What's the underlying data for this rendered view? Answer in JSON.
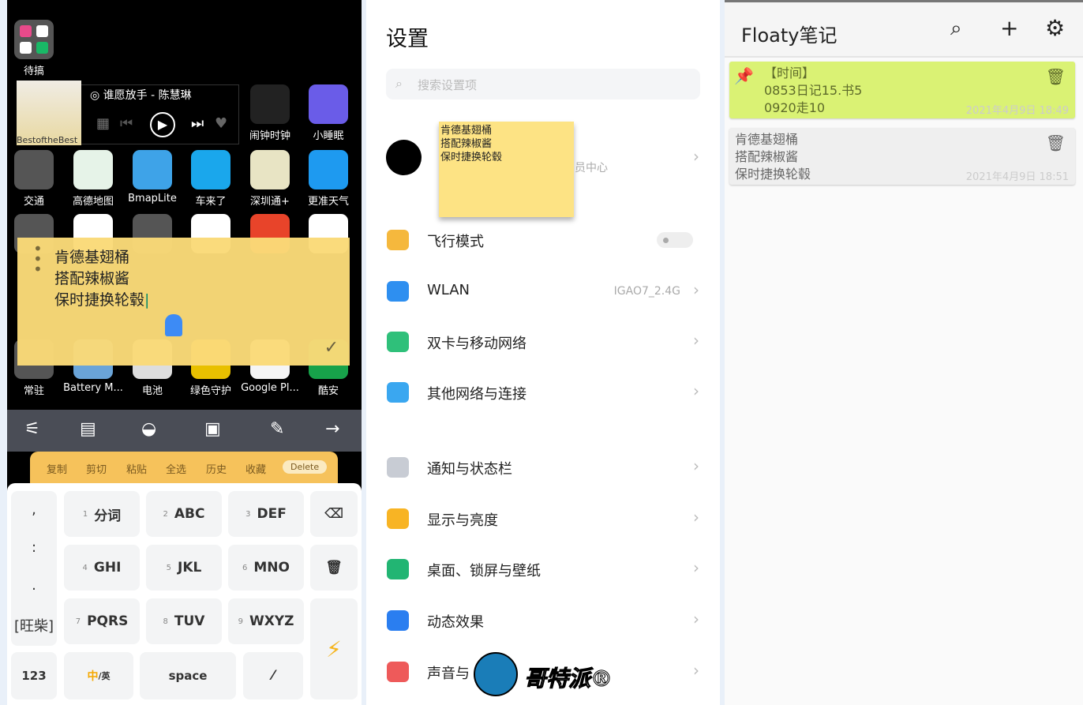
{
  "home": {
    "folder1_label": "待搞",
    "music": {
      "title": "谁愿放手 - 陈慧琳",
      "album_text": "BestoftheBest"
    },
    "apps": [
      {
        "label": "闹钟时钟",
        "color": "#222222"
      },
      {
        "label": "小睡眠",
        "color": "#6a5ce8"
      },
      {
        "label": "交通",
        "color": "#555555"
      },
      {
        "label": "高德地图",
        "color": "#e6f3e8"
      },
      {
        "label": "BmapLite",
        "color": "#3ea3e8"
      },
      {
        "label": "车来了",
        "color": "#1aa7ec"
      },
      {
        "label": "深圳通+",
        "color": "#e8e4c4"
      },
      {
        "label": "更准天气",
        "color": "#1e9af0"
      },
      {
        "label": "常驻",
        "color": "#555555"
      },
      {
        "label": "Battery M...",
        "color": "#6aa4d8"
      },
      {
        "label": "电池",
        "color": "#dddddd"
      },
      {
        "label": "绿色守护",
        "color": "#e8c000"
      },
      {
        "label": "Google Pl...",
        "color": "#f5f5f5"
      },
      {
        "label": "酷安",
        "color": "#17a24a"
      }
    ],
    "row4_colors": [
      "#555555",
      "#ffffff",
      "#555555",
      "#ffffff",
      "#e8442a",
      "#ffffff"
    ]
  },
  "floating_note": {
    "lines": [
      "肯德基翅桶",
      "搭配辣椒酱",
      "保时捷换轮毂"
    ],
    "confirm_icon": "check-icon"
  },
  "keyboard": {
    "toolbar_icons": [
      "sliders-icon",
      "voice-note-icon",
      "emoji-icon",
      "sticker-icon",
      "pen-icon",
      "arrow-right-icon"
    ],
    "clipboard": [
      "复制",
      "剪切",
      "粘贴",
      "全选",
      "历史",
      "收藏"
    ],
    "delete_label": "Delete",
    "punct": [
      ",",
      ":",
      ".",
      "[旺柴]"
    ],
    "keys": [
      {
        "n": "1",
        "l": "分词"
      },
      {
        "n": "2",
        "l": "ABC"
      },
      {
        "n": "3",
        "l": "DEF"
      },
      {
        "n": "4",
        "l": "GHI"
      },
      {
        "n": "5",
        "l": "JKL"
      },
      {
        "n": "6",
        "l": "MNO"
      },
      {
        "n": "7",
        "l": "PQRS"
      },
      {
        "n": "8",
        "l": "TUV"
      },
      {
        "n": "9",
        "l": "WXYZ"
      }
    ],
    "num_label": "123",
    "lang_zh": "中",
    "lang_en": "/英",
    "space_label": "space"
  },
  "settings": {
    "title": "设置",
    "search_placeholder": "搜索设置项",
    "account_sub": "员中心",
    "sticky_lines": [
      "肯德基翅桶",
      "搭配辣椒酱",
      "保时捷换轮毂"
    ],
    "items": [
      {
        "label": "飞行模式",
        "color": "#f5b83d"
      },
      {
        "label": "WLAN",
        "value": "IGAO7_2.4G",
        "color": "#2e8ff0"
      },
      {
        "label": "双卡与移动网络",
        "color": "#2fc07a"
      },
      {
        "label": "其他网络与连接",
        "color": "#3aa7f0"
      },
      {
        "label": "通知与状态栏",
        "color": "#c8ccd4"
      },
      {
        "label": "显示与亮度",
        "color": "#f8b424"
      },
      {
        "label": "桌面、锁屏与壁纸",
        "color": "#22b573"
      },
      {
        "label": "动态效果",
        "color": "#2a7ef0"
      },
      {
        "label": "声音与",
        "color": "#ee5a5a"
      }
    ],
    "watermark": "哥特派"
  },
  "floaty": {
    "title": "Floaty笔记",
    "notes": [
      {
        "lines": [
          "【时间】",
          "0853日记15.书5",
          "0920走10"
        ],
        "date": "2021年4月9日 18:49",
        "pinned": true,
        "color": "#daf274"
      },
      {
        "lines": [
          "肯德基翅桶",
          "搭配辣椒酱",
          "保时捷换轮毂"
        ],
        "date": "2021年4月9日 18:51",
        "pinned": false,
        "color": "#efefef"
      }
    ]
  }
}
